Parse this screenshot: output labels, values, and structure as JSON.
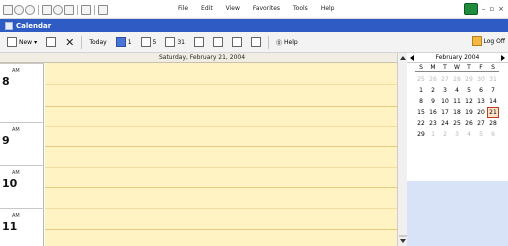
{
  "menu": [
    "File",
    "Edit",
    "View",
    "Favorites",
    "Tools",
    "Help"
  ],
  "header": {
    "title": "Calendar"
  },
  "toolbar": {
    "new_label": "New",
    "today_label": "Today",
    "day_1": "1",
    "day_5": "5",
    "day_31": "31",
    "help_label": "Help",
    "logoff_label": "Log Off"
  },
  "day_view": {
    "date": "Saturday, February 21, 2004",
    "hours": [
      {
        "ampm": "AM",
        "hour": "8"
      },
      {
        "ampm": "AM",
        "hour": "9"
      },
      {
        "ampm": "AM",
        "hour": "10"
      },
      {
        "ampm": "AM",
        "hour": "11"
      }
    ]
  },
  "mini_calendar": {
    "month": "February 2004",
    "dows": [
      "S",
      "M",
      "T",
      "W",
      "T",
      "F",
      "S"
    ],
    "weeks": [
      [
        "25",
        "26",
        "27",
        "28",
        "29",
        "30",
        "31"
      ],
      [
        "1",
        "2",
        "3",
        "4",
        "5",
        "6",
        "7"
      ],
      [
        "8",
        "9",
        "10",
        "11",
        "12",
        "13",
        "14"
      ],
      [
        "15",
        "16",
        "17",
        "18",
        "19",
        "20",
        "21"
      ],
      [
        "22",
        "23",
        "24",
        "25",
        "26",
        "27",
        "28"
      ],
      [
        "29",
        "1",
        "2",
        "3",
        "4",
        "5",
        "6"
      ]
    ],
    "selected": "21"
  }
}
